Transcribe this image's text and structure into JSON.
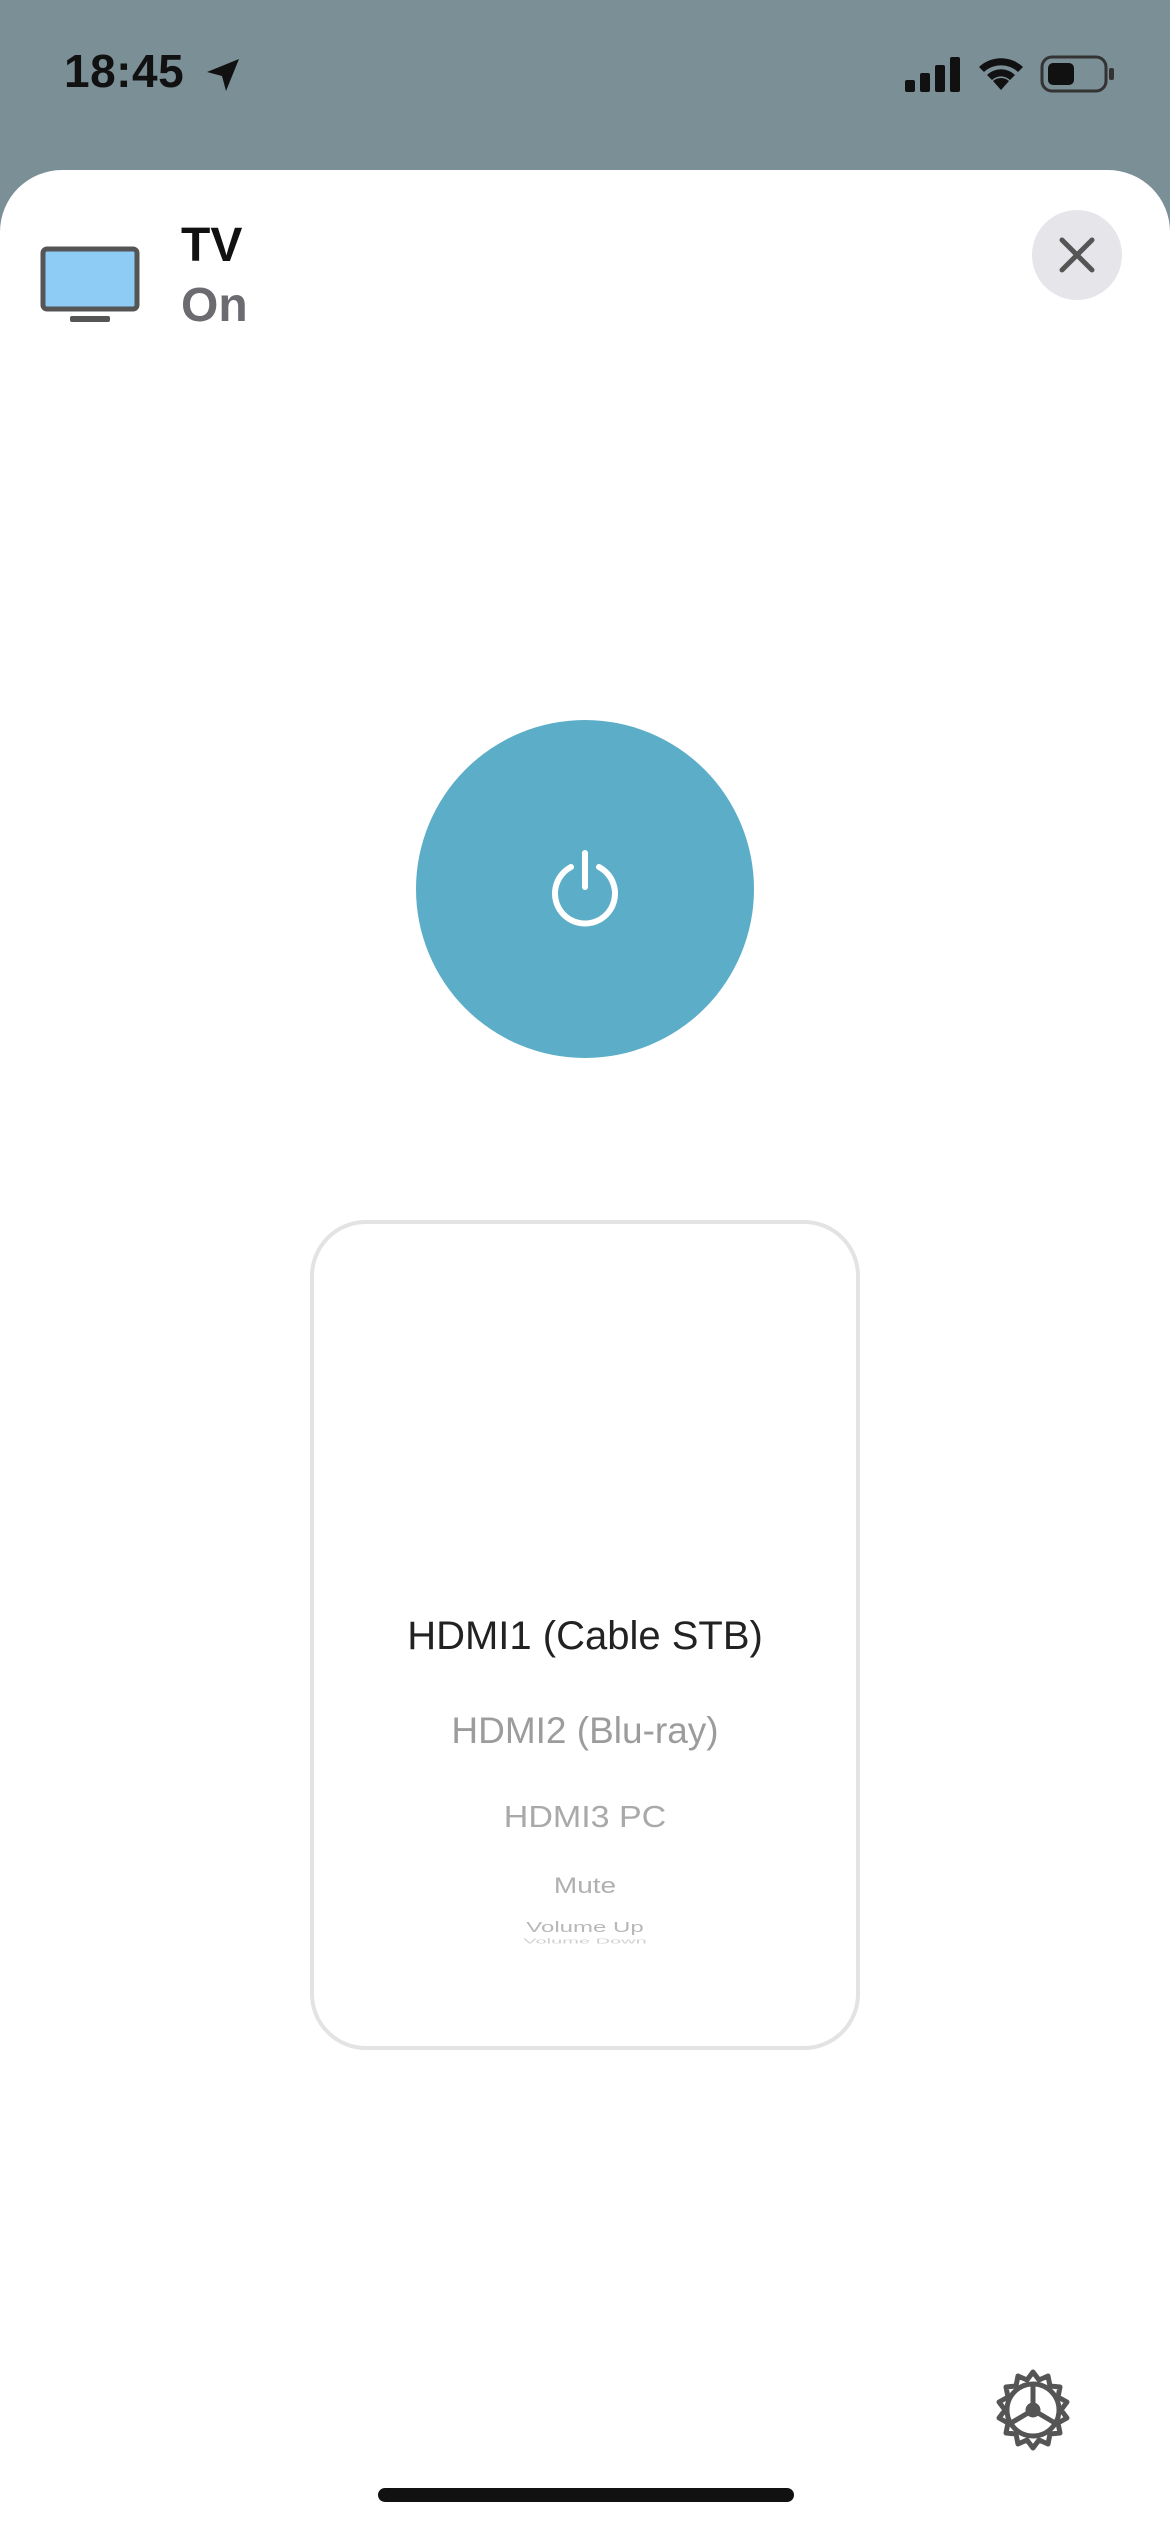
{
  "status_bar": {
    "time": "18:45",
    "icons": [
      "location-arrow-icon",
      "cellular-signal-icon",
      "wifi-icon",
      "battery-icon"
    ]
  },
  "device": {
    "icon": "tv-icon",
    "name": "TV",
    "state": "On"
  },
  "controls": {
    "close_icon": "close-icon",
    "power_icon": "power-icon",
    "power_color": "#5cadc7",
    "settings_icon": "gear-icon"
  },
  "input_picker": {
    "selected": "HDMI1 (Cable STB)",
    "options": [
      "HDMI1 (Cable STB)",
      "HDMI2 (Blu-ray)",
      "HDMI3 PC",
      "Mute",
      "Volume Up",
      "Volume Down"
    ]
  },
  "colors": {
    "backdrop": "#7b8f96",
    "sheet": "#ffffff",
    "tv_screen": "#8ecbf5"
  }
}
